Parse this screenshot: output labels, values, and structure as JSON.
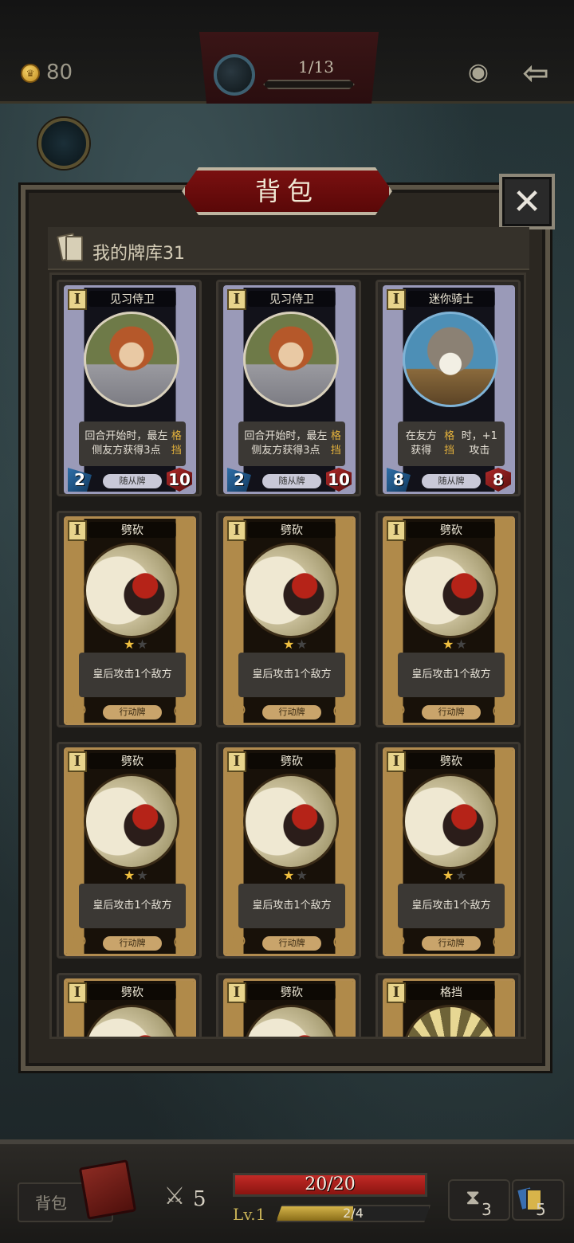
{
  "topbar": {
    "gold": "80",
    "stage_progress": "1/13",
    "icons": [
      "coin-icon",
      "portal-icon",
      "eye-icon",
      "back-arrow-icon"
    ]
  },
  "panel": {
    "title": "背包",
    "close_icon": "close-icon",
    "deck_label": "我的牌库31"
  },
  "cards": [
    {
      "kind": "minion",
      "art": "girl",
      "tier": "I",
      "name": "见习侍卫",
      "desc_pre": "回合开始时，最左侧友方获得3点",
      "desc_hl": "格挡",
      "desc_post": "",
      "type": "随从牌",
      "atk": "2",
      "hp": "10"
    },
    {
      "kind": "minion",
      "art": "girl",
      "tier": "I",
      "name": "见习侍卫",
      "desc_pre": "回合开始时，最左侧友方获得3点",
      "desc_hl": "格挡",
      "desc_post": "",
      "type": "随从牌",
      "atk": "2",
      "hp": "10"
    },
    {
      "kind": "minion",
      "art": "knight",
      "tier": "I",
      "name": "迷你骑士",
      "desc_pre": "在友方获得",
      "desc_hl": "格挡",
      "desc_post": "时，+1攻击",
      "type": "随从牌",
      "atk": "8",
      "hp": "8"
    },
    {
      "kind": "action",
      "art": "slash",
      "tier": "I",
      "name": "劈砍",
      "desc_pre": "皇后攻击1个敌方",
      "desc_hl": "",
      "desc_post": "",
      "type": "行动牌"
    },
    {
      "kind": "action",
      "art": "slash",
      "tier": "I",
      "name": "劈砍",
      "desc_pre": "皇后攻击1个敌方",
      "desc_hl": "",
      "desc_post": "",
      "type": "行动牌"
    },
    {
      "kind": "action",
      "art": "slash",
      "tier": "I",
      "name": "劈砍",
      "desc_pre": "皇后攻击1个敌方",
      "desc_hl": "",
      "desc_post": "",
      "type": "行动牌"
    },
    {
      "kind": "action",
      "art": "slash",
      "tier": "I",
      "name": "劈砍",
      "desc_pre": "皇后攻击1个敌方",
      "desc_hl": "",
      "desc_post": "",
      "type": "行动牌"
    },
    {
      "kind": "action",
      "art": "slash",
      "tier": "I",
      "name": "劈砍",
      "desc_pre": "皇后攻击1个敌方",
      "desc_hl": "",
      "desc_post": "",
      "type": "行动牌"
    },
    {
      "kind": "action",
      "art": "slash",
      "tier": "I",
      "name": "劈砍",
      "desc_pre": "皇后攻击1个敌方",
      "desc_hl": "",
      "desc_post": "",
      "type": "行动牌"
    },
    {
      "kind": "action",
      "art": "slash",
      "tier": "I",
      "name": "劈砍"
    },
    {
      "kind": "action",
      "art": "slash",
      "tier": "I",
      "name": "劈砍"
    },
    {
      "kind": "action",
      "art": "block",
      "tier": "I",
      "name": "格挡"
    }
  ],
  "bottom": {
    "bag_label": "背包",
    "attack": "5",
    "hp_text": "20/20",
    "hp_fraction": 1.0,
    "level": "Lv.1",
    "xp_text": "2/4",
    "xp_fraction": 0.5,
    "discard_count": "3",
    "draw_count": "5"
  },
  "colors": {
    "minion_border": "#9a9aba",
    "action_border": "#b18b4f",
    "highlight_text": "#e6b33c",
    "hp_red": "#c22a26",
    "xp_gold": "#d4b44a"
  }
}
